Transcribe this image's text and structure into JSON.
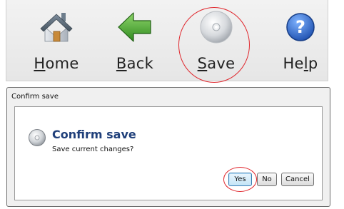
{
  "toolbar": {
    "items": [
      {
        "label_underlined": "H",
        "label_rest": "ome",
        "icon": "home-icon"
      },
      {
        "label_underlined": "B",
        "label_rest": "ack",
        "icon": "back-arrow-icon"
      },
      {
        "label_underlined": "S",
        "label_rest": "ave",
        "icon": "disc-save-icon"
      },
      {
        "label_pre": "He",
        "label_underlined": "l",
        "label_rest": "p",
        "icon": "help-icon"
      }
    ]
  },
  "dialog": {
    "title": "Confirm save",
    "heading": "Confirm save",
    "message": "Save current changes?",
    "icon": "disc-icon",
    "buttons": {
      "yes": "Yes",
      "no": "No",
      "cancel": "Cancel"
    }
  },
  "colors": {
    "highlight_ring": "#e0282e",
    "heading": "#1f3f7a",
    "back_arrow": "#3e9b2a",
    "help_icon": "#2b6cc4"
  }
}
